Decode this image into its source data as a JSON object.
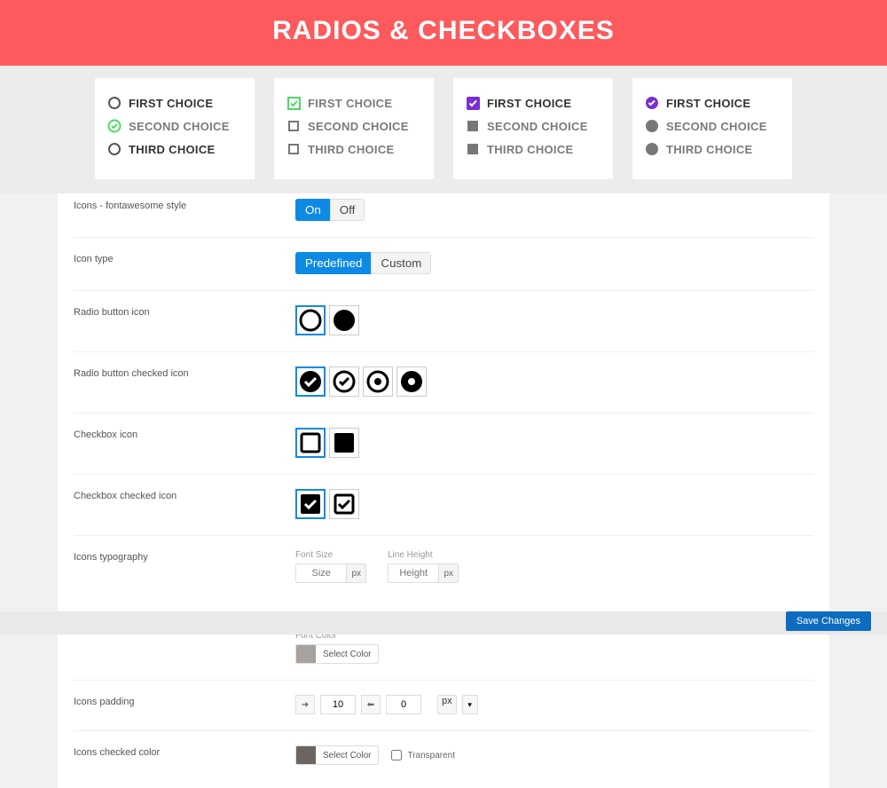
{
  "hero": {
    "title": "RADIOS & CHECKBOXES"
  },
  "preview": {
    "columns": [
      {
        "type": "radio-outline",
        "items": [
          {
            "label": "FIRST CHOICE",
            "checked": false
          },
          {
            "label": "SECOND CHOICE",
            "checked": true,
            "accent": "green"
          },
          {
            "label": "THIRD CHOICE",
            "checked": false
          }
        ]
      },
      {
        "type": "checkbox-outline",
        "items": [
          {
            "label": "FIRST CHOICE",
            "checked": true,
            "accent": "green"
          },
          {
            "label": "SECOND CHOICE",
            "checked": false
          },
          {
            "label": "THIRD CHOICE",
            "checked": false
          }
        ]
      },
      {
        "type": "checkbox-filled",
        "items": [
          {
            "label": "FIRST CHOICE",
            "checked": true,
            "accent": "purple"
          },
          {
            "label": "SECOND CHOICE",
            "checked": false
          },
          {
            "label": "THIRD CHOICE",
            "checked": false
          }
        ]
      },
      {
        "type": "radio-filled",
        "items": [
          {
            "label": "FIRST CHOICE",
            "checked": true,
            "accent": "purple"
          },
          {
            "label": "SECOND CHOICE",
            "checked": false
          },
          {
            "label": "THIRD CHOICE",
            "checked": false
          }
        ]
      }
    ]
  },
  "settings": {
    "fa_style": {
      "label": "Icons - fontawesome style",
      "on": "On",
      "off": "Off",
      "value": "on"
    },
    "icon_type": {
      "label": "Icon type",
      "predefined": "Predefined",
      "custom": "Custom",
      "value": "predefined"
    },
    "radio_icon": {
      "label": "Radio button icon",
      "selected": 0,
      "count": 2
    },
    "radio_checked_icon": {
      "label": "Radio button checked icon",
      "selected": 0,
      "count": 4
    },
    "checkbox_icon": {
      "label": "Checkbox icon",
      "selected": 0,
      "count": 2
    },
    "checkbox_checked_icon": {
      "label": "Checkbox checked icon",
      "selected": 0,
      "count": 2
    },
    "typography": {
      "label": "Icons typography",
      "font_size_label": "Font Size",
      "font_size_placeholder": "Size",
      "font_size_unit": "px",
      "line_height_label": "Line Height",
      "line_height_placeholder": "Height",
      "line_height_unit": "px",
      "font_color_label": "Font Color",
      "select_color": "Select Color"
    },
    "padding": {
      "label": "Icons padding",
      "v": "10",
      "h": "0",
      "unit": "px"
    },
    "checked_color": {
      "label": "Icons checked color",
      "select_color": "Select Color",
      "transparent_label": "Transparent"
    }
  },
  "footer": {
    "save": "Save Changes"
  }
}
